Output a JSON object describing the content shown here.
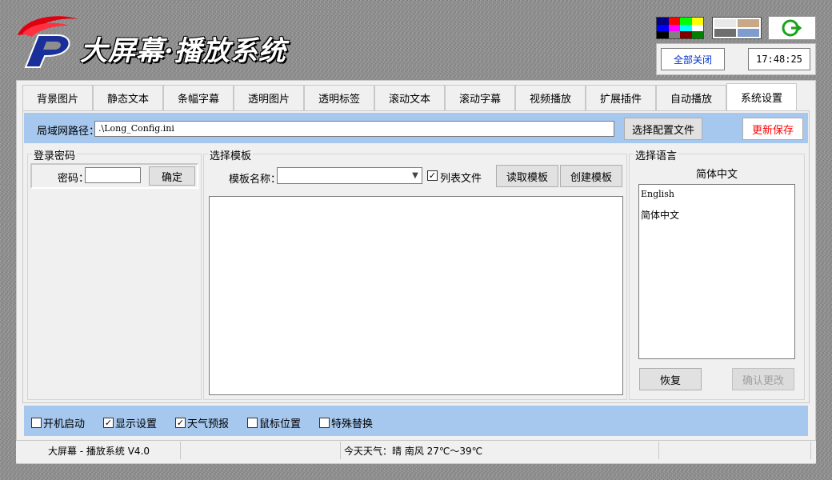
{
  "header": {
    "app_title": "大屏幕·播放系统",
    "close_all_label": "全部关闭",
    "clock": "17:48:25",
    "palette_colors": [
      "#000080",
      "#ff0000",
      "#00ff00",
      "#ffff00",
      "#0000ff",
      "#ff00ff",
      "#00ffff",
      "#ffffff",
      "#000000",
      "#808080",
      "#800000",
      "#008000"
    ],
    "texture_swatches": [
      "light-gray",
      "tan",
      "dark-gray",
      "blue-gray"
    ],
    "exit_icon": "power-exit-icon"
  },
  "tabs": [
    {
      "label": "背景图片"
    },
    {
      "label": "静态文本"
    },
    {
      "label": "条幅字幕"
    },
    {
      "label": "透明图片"
    },
    {
      "label": "透明标签"
    },
    {
      "label": "滚动文本"
    },
    {
      "label": "滚动字幕"
    },
    {
      "label": "视频播放"
    },
    {
      "label": "扩展插件"
    },
    {
      "label": "自动播放"
    },
    {
      "label": "系统设置",
      "active": true
    }
  ],
  "network_path": {
    "label": "局域网路径：",
    "value": ".\\Long_Config.ini",
    "choose_label": "选择配置文件",
    "update_label": "更新保存"
  },
  "login": {
    "title": "登录密码",
    "password_label": "密码：",
    "password_value": "",
    "confirm_label": "确定"
  },
  "template": {
    "title": "选择模板",
    "name_label": "模板名称：",
    "name_value": "",
    "list_file_label": "列表文件",
    "list_file_checked": true,
    "read_label": "读取模板",
    "create_label": "创建模板"
  },
  "language": {
    "title": "选择语言",
    "current": "简体中文",
    "options": [
      "English",
      "简体中文"
    ],
    "restore_label": "恢复",
    "confirm_label": "确认更改"
  },
  "options": [
    {
      "label": "开机启动",
      "checked": false
    },
    {
      "label": "显示设置",
      "checked": true
    },
    {
      "label": "天气预报",
      "checked": true
    },
    {
      "label": "鼠标位置",
      "checked": false
    },
    {
      "label": "特殊替换",
      "checked": false
    }
  ],
  "status": {
    "version": "大屏幕 - 播放系统 V4.0",
    "weather": "今天天气：晴 南风 27℃～39℃"
  }
}
